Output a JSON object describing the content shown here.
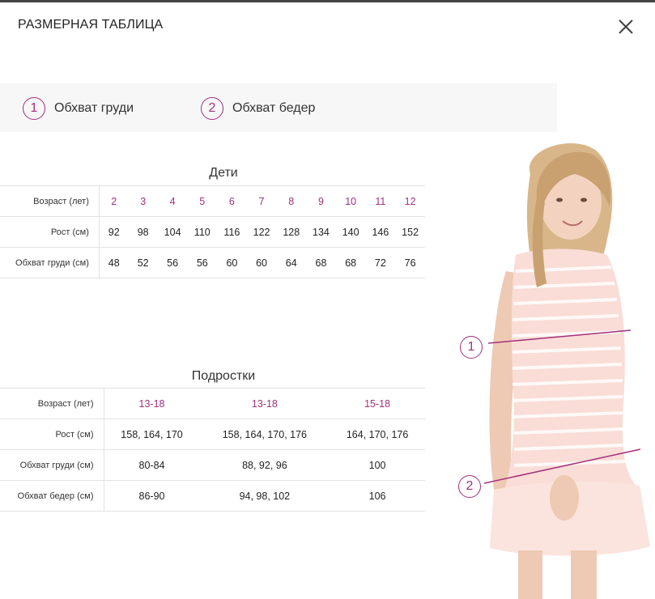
{
  "title": "РАЗМЕРНАЯ ТАБЛИЦА",
  "legend": [
    {
      "num": "1",
      "label": "Обхват груди"
    },
    {
      "num": "2",
      "label": "Обхват бедер"
    }
  ],
  "kids": {
    "title": "Дети",
    "rows": [
      {
        "label": "Возраст (лет)",
        "values": [
          "2",
          "3",
          "4",
          "5",
          "6",
          "7",
          "8",
          "9",
          "10",
          "11",
          "12"
        ]
      },
      {
        "label": "Рост (см)",
        "values": [
          "92",
          "98",
          "104",
          "110",
          "116",
          "122",
          "128",
          "134",
          "140",
          "146",
          "152"
        ]
      },
      {
        "label": "Обхват груди (см)",
        "values": [
          "48",
          "52",
          "56",
          "56",
          "60",
          "60",
          "64",
          "68",
          "68",
          "72",
          "76"
        ]
      }
    ]
  },
  "teens": {
    "title": "Подростки",
    "rows": [
      {
        "label": "Возраст (лет)",
        "values": [
          "13-18",
          "13-18",
          "15-18"
        ]
      },
      {
        "label": "Рост (см)",
        "values": [
          "158, 164, 170",
          "158, 164, 170, 176",
          "164, 170, 176"
        ]
      },
      {
        "label": "Обхват груди (см)",
        "values": [
          "80-84",
          "88, 92, 96",
          "100"
        ]
      },
      {
        "label": "Обхват бедер (см)",
        "values": [
          "86-90",
          "94, 98, 102",
          "106"
        ]
      }
    ]
  },
  "figure": {
    "marker1": "1",
    "marker2": "2"
  },
  "colors": {
    "accent": "#a3307c"
  },
  "icons": {
    "close": "close-icon"
  }
}
